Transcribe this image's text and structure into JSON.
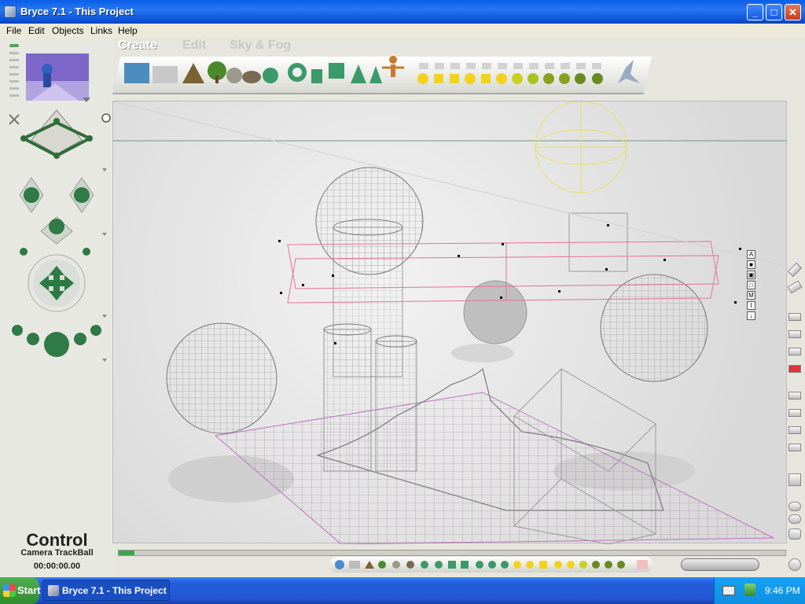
{
  "window": {
    "title": "Bryce 7.1  - This Project"
  },
  "menu": [
    "File",
    "Edit",
    "Objects",
    "Links",
    "Help"
  ],
  "tabs": {
    "create": "Create",
    "edit": "Edit",
    "sky": "Sky & Fog"
  },
  "view_buttons": [
    "A",
    "■",
    "▣",
    "□",
    "M",
    "I",
    "↓"
  ],
  "control": {
    "title": "Control",
    "mode": "Camera TrackBall",
    "time": "00:00:00.00"
  },
  "taskbar": {
    "start": "Start",
    "task": "Bryce 7.1  - This Project",
    "clock": "9:46 PM"
  },
  "icons": {
    "app": "bryce-app-icon",
    "minimize": "minimize-icon",
    "maximize": "maximize-icon",
    "close": "close-icon",
    "trackball": "camera-trackball-icon",
    "start_logo": "windows-logo-icon"
  },
  "colors": {
    "title_bar": "#0a5ee8",
    "taskbar": "#245edb",
    "start_button": "#3a9a3a",
    "wire_gray": "#777777",
    "wire_pink": "#e85a8a",
    "wire_yellow": "#e6e060"
  }
}
